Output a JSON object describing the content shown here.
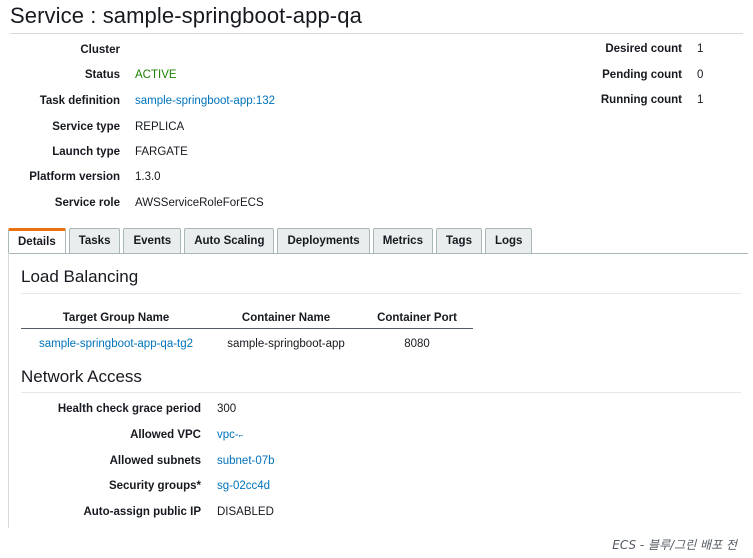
{
  "title": "Service : sample-springboot-app-qa",
  "summary": {
    "cluster_label": "Cluster",
    "cluster_value": "",
    "status_label": "Status",
    "status_value": "ACTIVE",
    "task_def_label": "Task definition",
    "task_def_value": "sample-springboot-app:132",
    "service_type_label": "Service type",
    "service_type_value": "REPLICA",
    "launch_type_label": "Launch type",
    "launch_type_value": "FARGATE",
    "platform_label": "Platform version",
    "platform_value": "1.3.0",
    "role_label": "Service role",
    "role_value": "AWSServiceRoleForECS",
    "desired_label": "Desired count",
    "desired_value": "1",
    "pending_label": "Pending count",
    "pending_value": "0",
    "running_label": "Running count",
    "running_value": "1"
  },
  "tabs": [
    "Details",
    "Tasks",
    "Events",
    "Auto Scaling",
    "Deployments",
    "Metrics",
    "Tags",
    "Logs"
  ],
  "load_balancing": {
    "title": "Load Balancing",
    "headers": [
      "Target Group Name",
      "Container Name",
      "Container Port"
    ],
    "row": [
      "sample-springboot-app-qa-tg2",
      "sample-springboot-app",
      "8080"
    ]
  },
  "network": {
    "title": "Network Access",
    "grace_label": "Health check grace period",
    "grace_value": "300",
    "vpc_label": "Allowed VPC",
    "vpc_value": "vpc-",
    "subnets_label": "Allowed subnets",
    "subnets_value": "subnet-07b",
    "sg_label": "Security groups*",
    "sg_value": "sg-02cc4d",
    "public_ip_label": "Auto-assign public IP",
    "public_ip_value": "DISABLED"
  },
  "caption": "ECS - 블루/그린 배포 전",
  "colors": {
    "accent": "#ec7211",
    "link": "#0073bb",
    "active": "#1d8102"
  }
}
